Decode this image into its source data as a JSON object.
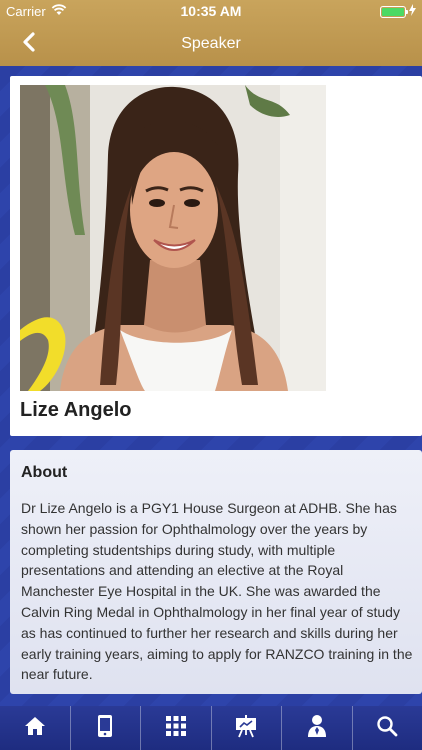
{
  "status_bar": {
    "carrier": "Carrier",
    "time": "10:35 AM",
    "battery_level": 1.0
  },
  "nav": {
    "title": "Speaker",
    "back_icon": "chevron-left-icon"
  },
  "speaker": {
    "name": "Lize Angelo"
  },
  "about": {
    "title": "About",
    "text": "Dr Lize Angelo is a PGY1 House Surgeon at ADHB. She has shown her passion for Ophthalmology over the years by completing studentships during study, with multiple presentations and attending an elective at the Royal Manchester Eye Hospital in the UK. She was awarded the Calvin Ring Medal in Ophthalmology in her final year of study as has continued to further her research and skills during her early training years, aiming to apply for RANZCO training in the near future."
  },
  "tab_bar": {
    "tabs": [
      {
        "icon": "home-icon"
      },
      {
        "icon": "mobile-device-icon"
      },
      {
        "icon": "grid-icon"
      },
      {
        "icon": "presentation-board-icon"
      },
      {
        "icon": "speaker-person-icon"
      },
      {
        "icon": "search-icon"
      }
    ]
  },
  "colors": {
    "header_gold": "#c9a45c",
    "background_blue": "#2a3e9e",
    "battery_green": "#4cd964"
  }
}
